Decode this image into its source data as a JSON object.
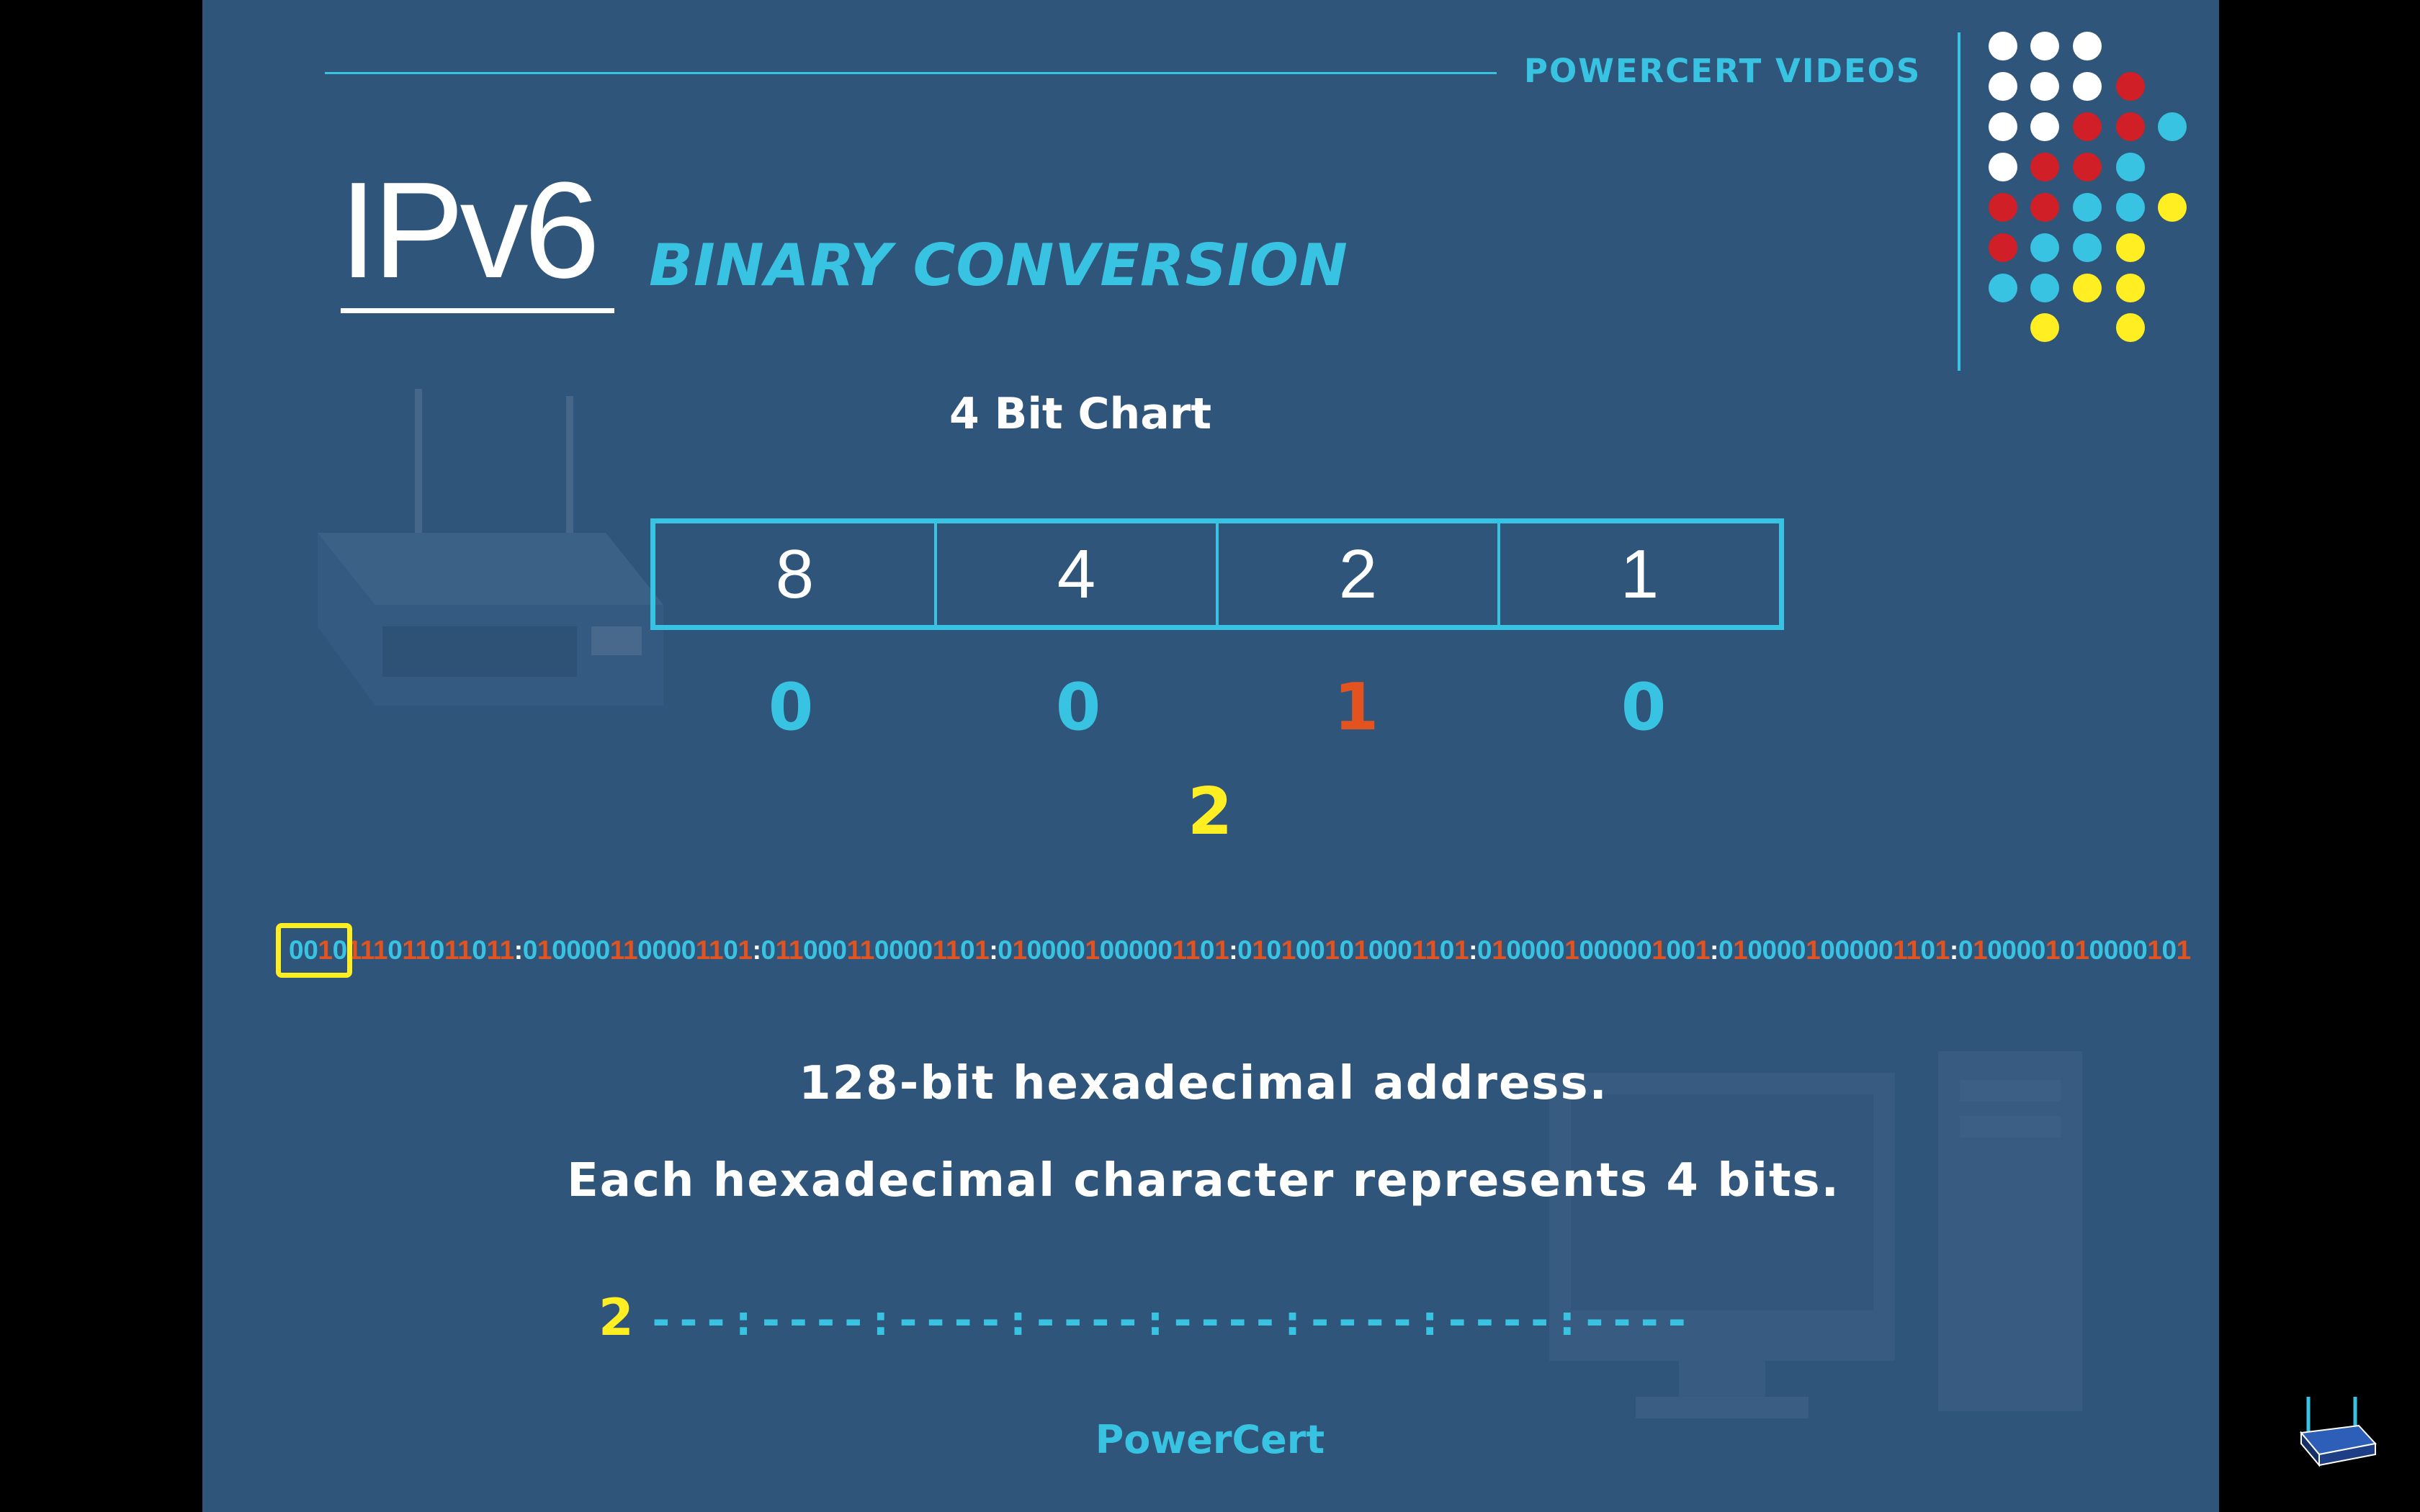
{
  "brand": {
    "top_label": "POWERCERT VIDEOS",
    "footer_label": "PowerCert"
  },
  "title": {
    "main": "IPv6",
    "subtitle": "BINARY CONVERSION"
  },
  "chart": {
    "title": "4 Bit Chart",
    "positions": [
      "8",
      "4",
      "2",
      "1"
    ],
    "bits": [
      {
        "value": "0",
        "color": "#39c3e3"
      },
      {
        "value": "0",
        "color": "#39c3e3"
      },
      {
        "value": "1",
        "color": "#e2531f"
      },
      {
        "value": "0",
        "color": "#39c3e3"
      }
    ],
    "result": "2"
  },
  "binary_address": "0010111011011011:0100001100001101:0110001100001101:0100001000001101:0101001010001101:0100001000001001:0100001000001101:0100001010000101",
  "description": {
    "line1": "128-bit hexadecimal address.",
    "line2": "Each hexadecimal character represents 4 bits."
  },
  "hex_progress": {
    "first_char": "2",
    "remaining": "---:----:----:----:----:----:----:----"
  },
  "colors": {
    "background": "#30557a",
    "accent_cyan": "#39c3e3",
    "bit_one_orange": "#e2531f",
    "highlight_yellow": "#ffee22",
    "dot_white": "#ffffff",
    "dot_red": "#d01f26"
  },
  "icons": [
    "router-watermark",
    "computer-watermark",
    "decorative-dot-grid",
    "router-corner-logo"
  ]
}
